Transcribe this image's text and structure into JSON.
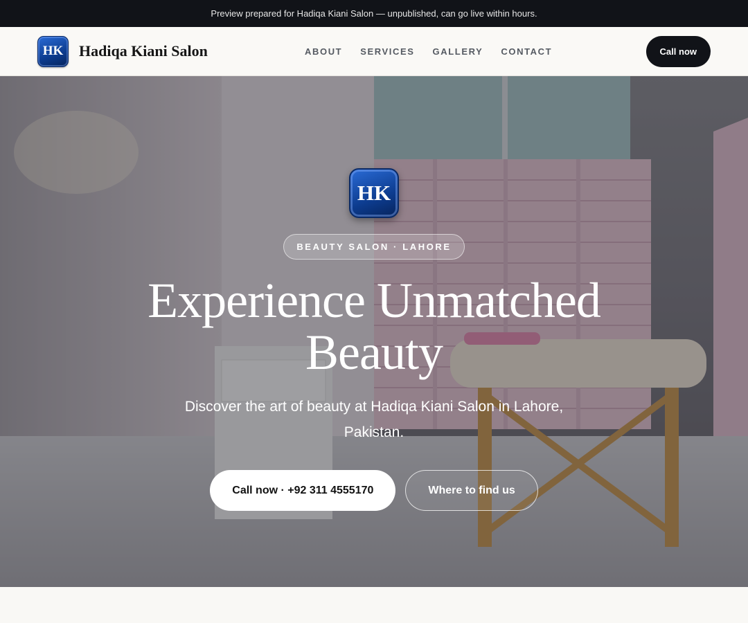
{
  "announcement": "Preview prepared for Hadiqa Kiani Salon — unpublished, can go live within hours.",
  "brand": {
    "logo_text": "HK",
    "name": "Hadiqa Kiani Salon",
    "logo_colors": [
      "#2a6bd6",
      "#0d3c8f",
      "#06245c"
    ]
  },
  "nav": {
    "items": [
      {
        "label": "ABOUT"
      },
      {
        "label": "SERVICES"
      },
      {
        "label": "GALLERY"
      },
      {
        "label": "CONTACT"
      }
    ],
    "cta_label": "Call now"
  },
  "hero": {
    "logo_text": "HK",
    "eyebrow": "BEAUTY SALON · LAHORE",
    "title": "Experience Unmatched Beauty",
    "subtitle": "Discover the art of beauty at Hadiqa Kiani Salon in Lahore, Pakistan.",
    "primary_button": "Call now · +92 311 4555170",
    "secondary_button": "Where to find us",
    "background_image": "salon-treatment-room-photo"
  },
  "colors": {
    "dark": "#111318",
    "page_background": "#f9f8f5",
    "nav_text": "#555a62"
  }
}
